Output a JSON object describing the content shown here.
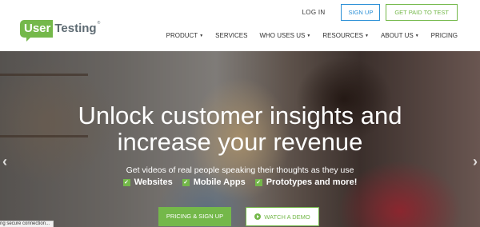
{
  "header": {
    "logo": {
      "part1": "User",
      "part2": "Testing",
      "tm": "®"
    },
    "top_links": {
      "login": "LOG IN",
      "signup": "SIGN UP",
      "get_paid": "GET PAID TO TEST"
    },
    "nav": [
      {
        "label": "PRODUCT",
        "dropdown": true
      },
      {
        "label": "SERVICES",
        "dropdown": false
      },
      {
        "label": "WHO USES US",
        "dropdown": true
      },
      {
        "label": "RESOURCES",
        "dropdown": true
      },
      {
        "label": "ABOUT US",
        "dropdown": true
      },
      {
        "label": "PRICING",
        "dropdown": false
      }
    ],
    "caret": "▼"
  },
  "hero": {
    "headline_line1": "Unlock customer insights and",
    "headline_line2": "increase your revenue",
    "subline": "Get videos of real people speaking their thoughts as they use",
    "features": [
      "Websites",
      "Mobile Apps",
      "Prototypes and more!"
    ],
    "check_glyph": "✓",
    "cta_primary": "PRICING & SIGN UP",
    "cta_secondary": "WATCH A DEMO",
    "arrow_left": "‹",
    "arrow_right": "›"
  },
  "status_bar": {
    "text": "ng secure connection..."
  },
  "colors": {
    "brand_green": "#74b84a",
    "brand_blue": "#2a8fd6",
    "logo_gray": "#5e6b73"
  }
}
